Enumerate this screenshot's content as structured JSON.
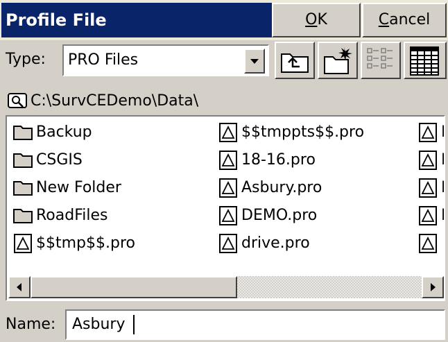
{
  "dialog": {
    "title": "Profile File",
    "ok_label": "OK",
    "ok_mnemonic_rest": "K",
    "ok_mnemonic": "O",
    "cancel_mnemonic": "C",
    "cancel_rest": "ancel",
    "cancel_label": "Cancel"
  },
  "type": {
    "label": "Type:",
    "selected": "PRO Files"
  },
  "path": "C:\\SurvCEDemo\\Data\\",
  "files": {
    "column1": [
      {
        "name": "Backup",
        "kind": "folder"
      },
      {
        "name": "CSGIS",
        "kind": "folder"
      },
      {
        "name": "New Folder",
        "kind": "folder"
      },
      {
        "name": "RoadFiles",
        "kind": "folder"
      },
      {
        "name": "$$tmp$$.pro",
        "kind": "file"
      }
    ],
    "column2": [
      {
        "name": "$$tmppts$$.pro",
        "kind": "file"
      },
      {
        "name": "18-16.pro",
        "kind": "file"
      },
      {
        "name": "Asbury.pro",
        "kind": "file"
      },
      {
        "name": "DEMO.pro",
        "kind": "file"
      },
      {
        "name": "drive.pro",
        "kind": "file"
      }
    ],
    "column3_partial": [
      {
        "name": "I",
        "kind": "file"
      },
      {
        "name": "I",
        "kind": "file"
      },
      {
        "name": "I",
        "kind": "file"
      },
      {
        "name": "I",
        "kind": "file"
      },
      {
        "name": "",
        "kind": "file"
      }
    ]
  },
  "name": {
    "label": "Name:",
    "value": "Asbury"
  },
  "icons": {
    "tool1": "up-folder-icon",
    "tool2": "new-folder-icon",
    "tool3": "list-view-icon",
    "tool4": "details-view-icon",
    "path": "drive-magnifier-icon"
  }
}
